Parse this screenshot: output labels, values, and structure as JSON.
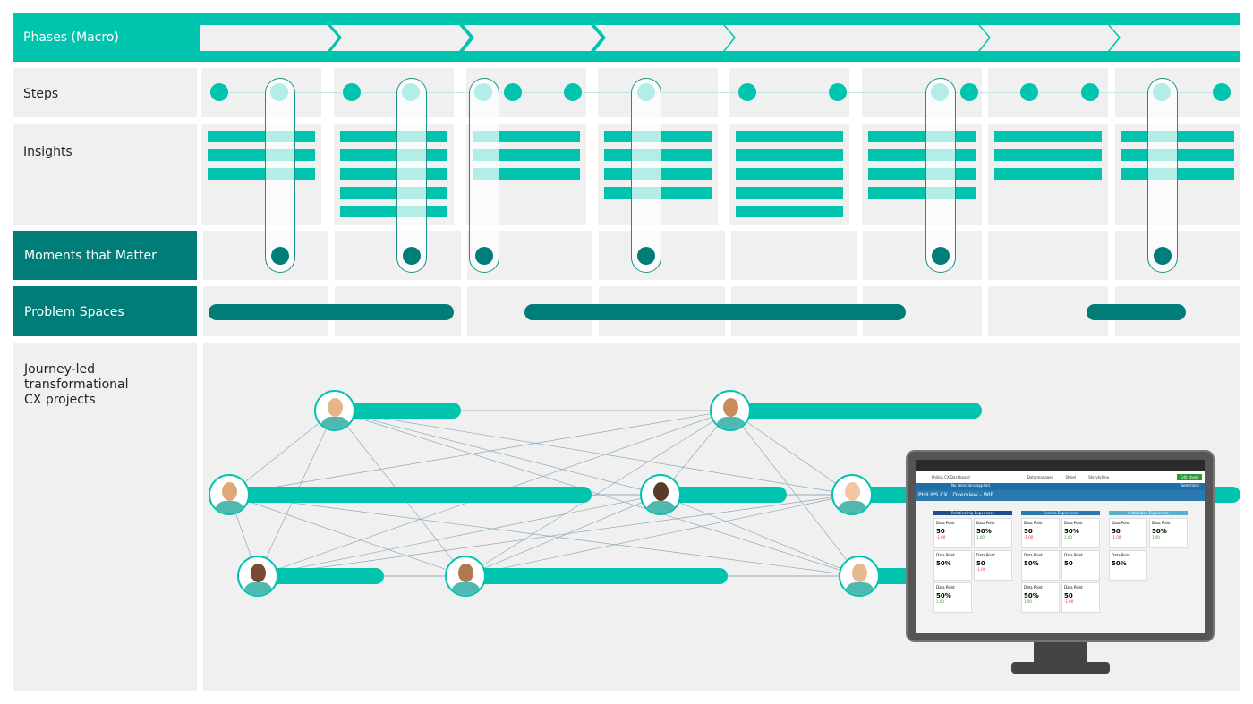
{
  "rows": {
    "phases": "Phases (Macro)",
    "steps": "Steps",
    "insights": "Insights",
    "moments": "Moments that Matter",
    "problems": "Problem Spaces",
    "journey": "Journey-led transformational CX projects"
  },
  "colors": {
    "teal": "#00c4ae",
    "dark_teal": "#007d78",
    "cell": "#f0f0f0",
    "blue": "#2a7ab0"
  },
  "insight_counts": [
    3,
    5,
    3,
    4,
    5,
    4,
    3,
    3
  ],
  "dashboard": {
    "app_title": "Philips CX Dashboard",
    "nav": [
      "Data manager",
      "Sheet",
      "Storytelling"
    ],
    "edit_button": "Edit sheet",
    "selections_status": "No selections applied",
    "selections_button": "Selections",
    "sheet_title": "PHILIPS CX | Overview - WIP",
    "groups": [
      {
        "title": "Relationship Experience",
        "cards": [
          {
            "label": "Data Point",
            "value": "50",
            "delta": "-1.00"
          },
          {
            "label": "Data Point",
            "value": "50%",
            "delta": "1.00"
          },
          {
            "label": "Data Point",
            "value": "50%",
            "delta": ""
          },
          {
            "label": "Data Point",
            "value": "50",
            "delta": "-1.00"
          },
          {
            "label": "Data Point",
            "value": "50%",
            "delta": "1.00"
          }
        ]
      },
      {
        "title": "Service Experience",
        "cards": [
          {
            "label": "Data Point",
            "value": "50",
            "delta": "-1.00"
          },
          {
            "label": "Data Point",
            "value": "50%",
            "delta": "1.00"
          },
          {
            "label": "Data Point",
            "value": "50%",
            "delta": ""
          },
          {
            "label": "Data Point",
            "value": "50",
            "delta": ""
          },
          {
            "label": "Data Point",
            "value": "50%",
            "delta": "1.00"
          },
          {
            "label": "Data Point",
            "value": "50",
            "delta": "-1.00"
          }
        ]
      },
      {
        "title": "Installation Experience",
        "cards": [
          {
            "label": "Data Point",
            "value": "50",
            "delta": "-1.00"
          },
          {
            "label": "Data Point",
            "value": "50%",
            "delta": "1.00"
          },
          {
            "label": "Data Point",
            "value": "50%",
            "delta": ""
          }
        ]
      }
    ]
  }
}
